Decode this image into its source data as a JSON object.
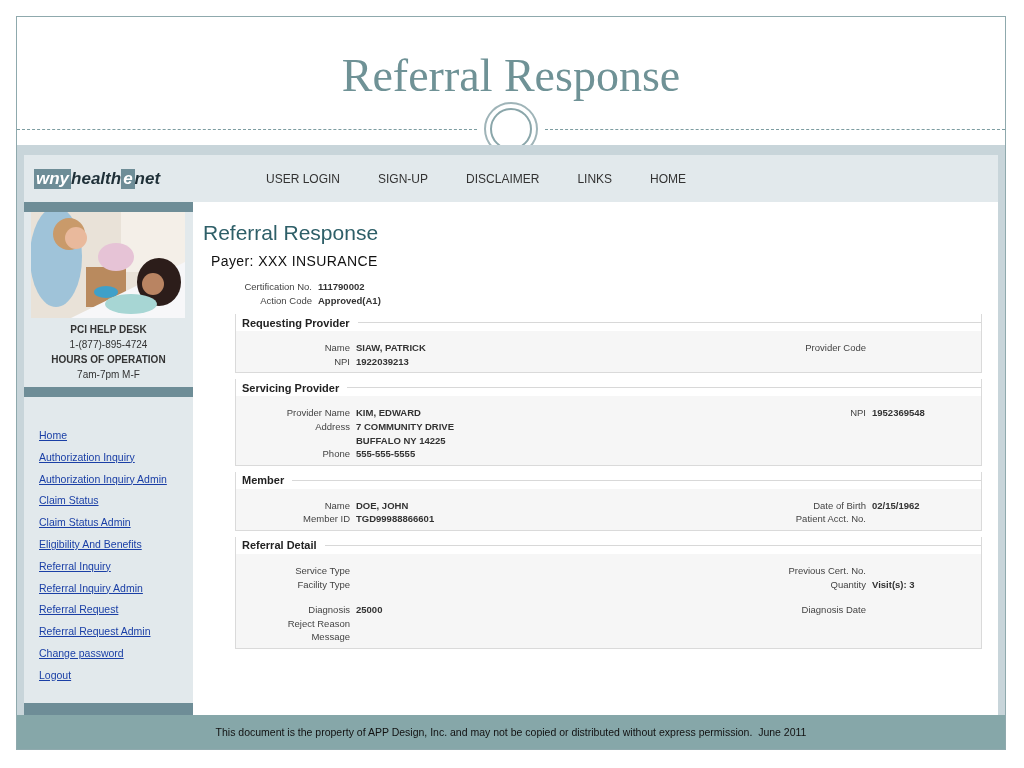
{
  "slide_title": "Referral Response",
  "logo": [
    {
      "text": "wny",
      "kind": "boxed"
    },
    {
      "text": "health",
      "kind": "plain"
    },
    {
      "text": "e",
      "kind": "boxed"
    },
    {
      "text": "net",
      "kind": "plain"
    }
  ],
  "nav": [
    "USER LOGIN",
    "SIGN-UP",
    "DISCLAIMER",
    "LINKS",
    "HOME"
  ],
  "sidebar": {
    "help": [
      {
        "text": "PCI HELP DESK",
        "kind": "heading"
      },
      {
        "text": "1-(877)-895-4724",
        "kind": "plain"
      },
      {
        "text": "HOURS OF OPERATION",
        "kind": "heading"
      },
      {
        "text": "7am-7pm M-F",
        "kind": "plain"
      }
    ],
    "links": [
      "Home",
      "Authorization Inquiry",
      "Authorization Inquiry Admin",
      "Claim Status",
      "Claim Status Admin",
      "Eligibility And Benefits",
      "Referral Inquiry",
      "Referral Inquiry Admin",
      "Referral Request",
      "Referral Request Admin",
      "Change password",
      "Logout"
    ]
  },
  "page_title": "Referral Response",
  "payer": "Payer: XXX INSURANCE",
  "summary": [
    {
      "label": "Certification No.",
      "value": "111790002"
    },
    {
      "label": "Action Code",
      "value": "Approved(A1)"
    }
  ],
  "sections": [
    {
      "title": "Requesting Provider",
      "left": [
        {
          "label": "Name",
          "value": "SIAW, PATRICK"
        },
        {
          "label": "NPI",
          "value": "1922039213"
        }
      ],
      "right": [
        {
          "label": "Provider Code"
        }
      ]
    },
    {
      "title": "Servicing Provider",
      "left": [
        {
          "label": "Provider Name",
          "value": "KIM, EDWARD"
        },
        {
          "label": "Address",
          "value": "7 COMMUNITY DRIVE"
        },
        {
          "value": "BUFFALO NY 14225"
        },
        {
          "label": "Phone",
          "value": "555-555-5555"
        }
      ],
      "right": [
        {
          "label": "NPI",
          "value": "1952369548"
        }
      ]
    },
    {
      "title": "Member",
      "left": [
        {
          "label": "Name",
          "value": "DOE, JOHN"
        },
        {
          "label": "Member ID",
          "value": "TGD99988866601"
        }
      ],
      "right": [
        {
          "label": "Date of Birth",
          "value": "02/15/1962"
        },
        {
          "label": "Patient Acct. No."
        }
      ]
    },
    {
      "title": "Referral Detail",
      "left": [
        {
          "label": "Service Type"
        },
        {
          "label": "Facility Type"
        },
        {
          "kind": "gap"
        },
        {
          "label": "Diagnosis",
          "value": "25000"
        },
        {
          "label": "Reject Reason"
        },
        {
          "label": "Message"
        }
      ],
      "right": [
        {
          "label": "Previous Cert. No."
        },
        {
          "label": "Quantity",
          "value": "Visit(s): 3"
        },
        {
          "kind": "gap"
        },
        {
          "label": "Diagnosis Date"
        }
      ]
    }
  ],
  "footer": "This document is the property of APP Design, Inc. and may not be copied or distributed without express permission.  June 2011"
}
